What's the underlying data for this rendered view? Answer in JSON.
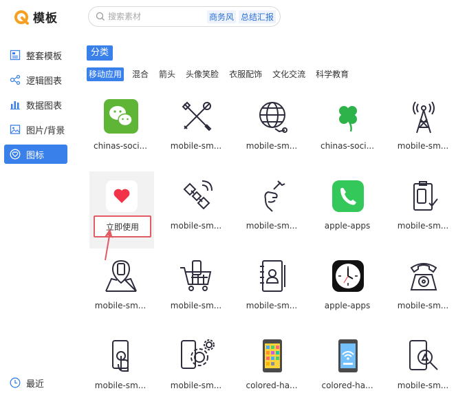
{
  "app": {
    "title": "模板"
  },
  "search": {
    "placeholder": "搜索素材",
    "tags": [
      "商务风",
      "总结汇报"
    ]
  },
  "sidebar": {
    "items": [
      {
        "label": "整套模板",
        "icon": "template-icon"
      },
      {
        "label": "逻辑图表",
        "icon": "logic-chart-icon"
      },
      {
        "label": "数据图表",
        "icon": "bar-chart-icon"
      },
      {
        "label": "图片/背景",
        "icon": "image-icon"
      },
      {
        "label": "图标",
        "icon": "heart-circle-icon",
        "active": true
      }
    ],
    "recent": {
      "label": "最近",
      "icon": "clock-icon"
    }
  },
  "category": {
    "title": "分类",
    "filters": [
      "移动应用",
      "混合",
      "箭头",
      "头像笑脸",
      "衣服配饰",
      "文化交流",
      "科学教育"
    ],
    "active": 0
  },
  "tiles": [
    {
      "label": "chinas-soci...",
      "icon": "wechat-icon"
    },
    {
      "label": "mobile-sm...",
      "icon": "tools-icon"
    },
    {
      "label": "mobile-sm...",
      "icon": "globe-network-icon"
    },
    {
      "label": "chinas-soci...",
      "icon": "clover-icon"
    },
    {
      "label": "mobile-sm...",
      "icon": "antenna-tower-icon"
    },
    {
      "label": "",
      "icon": "health-heart-icon"
    },
    {
      "label": "mobile-sm...",
      "icon": "satellite-icon"
    },
    {
      "label": "mobile-sm...",
      "icon": "hand-wrench-icon"
    },
    {
      "label": "apple-apps",
      "icon": "phone-app-icon"
    },
    {
      "label": "mobile-sm...",
      "icon": "clipboard-phone-icon"
    },
    {
      "label": "mobile-sm...",
      "icon": "map-pin-phone-icon"
    },
    {
      "label": "mobile-sm...",
      "icon": "cart-phone-icon"
    },
    {
      "label": "mobile-sm...",
      "icon": "contacts-book-icon"
    },
    {
      "label": "apple-apps",
      "icon": "clock-app-icon"
    },
    {
      "label": "mobile-sm...",
      "icon": "retro-phone-icon"
    },
    {
      "label": "mobile-sm...",
      "icon": "touch-phone-icon"
    },
    {
      "label": "mobile-sm...",
      "icon": "phone-gear-icon"
    },
    {
      "label": "colored-ha...",
      "icon": "colored-phone-icon"
    },
    {
      "label": "colored-ha...",
      "icon": "wifi-phone-icon"
    },
    {
      "label": "mobile-sm...",
      "icon": "phone-search-icon"
    }
  ],
  "use_button": {
    "label": "立即使用"
  },
  "colors": {
    "accent": "#3a80ea",
    "highlight_border": "#e25a63"
  }
}
